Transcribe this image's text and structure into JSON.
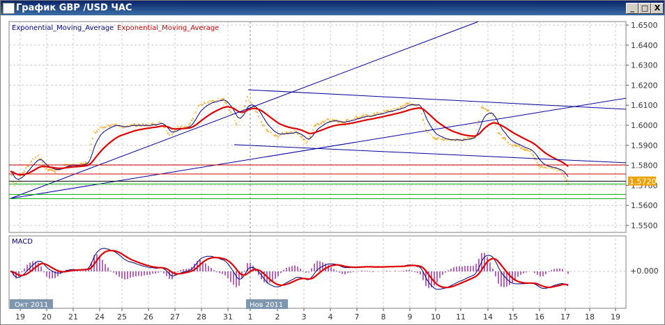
{
  "window": {
    "title": "График GBP /USD  ЧАС",
    "buttons": {
      "minimize": "_",
      "maximize": "□",
      "close": "X"
    }
  },
  "legend": {
    "ema1": "Exponential_Moving_Average",
    "ema2": "Exponential_Moving_Average",
    "macd": "MACD"
  },
  "colors": {
    "price": "#f0a000",
    "ema_fast": "#000080",
    "ema_slow": "#e00000",
    "trend": "#0000a0",
    "macd_hist": "#800080",
    "green": "#00b000",
    "red_line": "#d00000"
  },
  "chart_data": {
    "type": "line",
    "symbol": "GBP/USD",
    "timeframe": "hour",
    "ylim": [
      1.55,
      1.65
    ],
    "y_ticks": [
      "1.6500",
      "1.6400",
      "1.6300",
      "1.6200",
      "1.6100",
      "1.6000",
      "1.5900",
      "1.5800",
      "1.5700",
      "1.5600",
      "1.5500"
    ],
    "current_price": "1.5720",
    "x_ticks": [
      "19",
      "20",
      "21",
      "24",
      "25",
      "26",
      "27",
      "28",
      "31",
      "1",
      "2",
      "3",
      "4",
      "7",
      "8",
      "9",
      "10",
      "11",
      "14",
      "15",
      "16",
      "17",
      "18",
      "19"
    ],
    "month_labels": [
      "Окт 2011",
      "Нов 2011"
    ],
    "macd_zero_label": "+0.000",
    "price_keypoints": [
      [
        0,
        1.577
      ],
      [
        3,
        1.57
      ],
      [
        8,
        1.5752
      ],
      [
        15,
        1.5823
      ],
      [
        20,
        1.5851
      ],
      [
        25,
        1.5782
      ],
      [
        33,
        1.5771
      ],
      [
        40,
        1.5806
      ],
      [
        48,
        1.5799
      ],
      [
        55,
        1.5816
      ],
      [
        60,
        1.5962
      ],
      [
        65,
        1.5986
      ],
      [
        73,
        1.6003
      ],
      [
        80,
        1.599
      ],
      [
        88,
        1.6003
      ],
      [
        98,
        1.5997
      ],
      [
        108,
        1.6014
      ],
      [
        115,
        1.5944
      ],
      [
        120,
        1.599
      ],
      [
        128,
        1.5997
      ],
      [
        135,
        1.6101
      ],
      [
        143,
        1.6118
      ],
      [
        153,
        1.6135
      ],
      [
        158,
        1.6066
      ],
      [
        163,
        1.5997
      ],
      [
        170,
        1.6135
      ],
      [
        175,
        1.6083
      ],
      [
        183,
        1.5979
      ],
      [
        190,
        1.5944
      ],
      [
        198,
        1.5962
      ],
      [
        205,
        1.5969
      ],
      [
        213,
        1.591
      ],
      [
        218,
        1.5997
      ],
      [
        228,
        1.6031
      ],
      [
        238,
        1.6014
      ],
      [
        248,
        1.6038
      ],
      [
        258,
        1.6049
      ],
      [
        268,
        1.6066
      ],
      [
        278,
        1.6083
      ],
      [
        285,
        1.6108
      ],
      [
        293,
        1.6101
      ],
      [
        298,
        1.5979
      ],
      [
        305,
        1.5934
      ],
      [
        313,
        1.5927
      ],
      [
        323,
        1.5927
      ],
      [
        333,
        1.5944
      ],
      [
        338,
        1.6083
      ],
      [
        345,
        1.6066
      ],
      [
        350,
        1.5962
      ],
      [
        358,
        1.591
      ],
      [
        365,
        1.5893
      ],
      [
        373,
        1.5875
      ],
      [
        380,
        1.5788
      ],
      [
        388,
        1.5788
      ],
      [
        395,
        1.5771
      ],
      [
        400,
        1.5712
      ]
    ],
    "trend_lines": [
      [
        0,
        1.5635,
        335.5,
        1.6517
      ],
      [
        0,
        1.5635,
        441.5,
        1.6135
      ],
      [
        170.5,
        1.6177,
        441.5,
        1.608
      ],
      [
        160.5,
        1.5903,
        441.5,
        1.5813
      ]
    ],
    "horizontal_lines": [
      {
        "price": 1.5802,
        "color": "red"
      },
      {
        "price": 1.5757,
        "color": "red"
      },
      {
        "price": 1.5721,
        "color": "black"
      },
      {
        "price": 1.5707,
        "color": "green"
      },
      {
        "price": 1.5655,
        "color": "green"
      },
      {
        "price": 1.5634,
        "color": "green"
      }
    ]
  }
}
